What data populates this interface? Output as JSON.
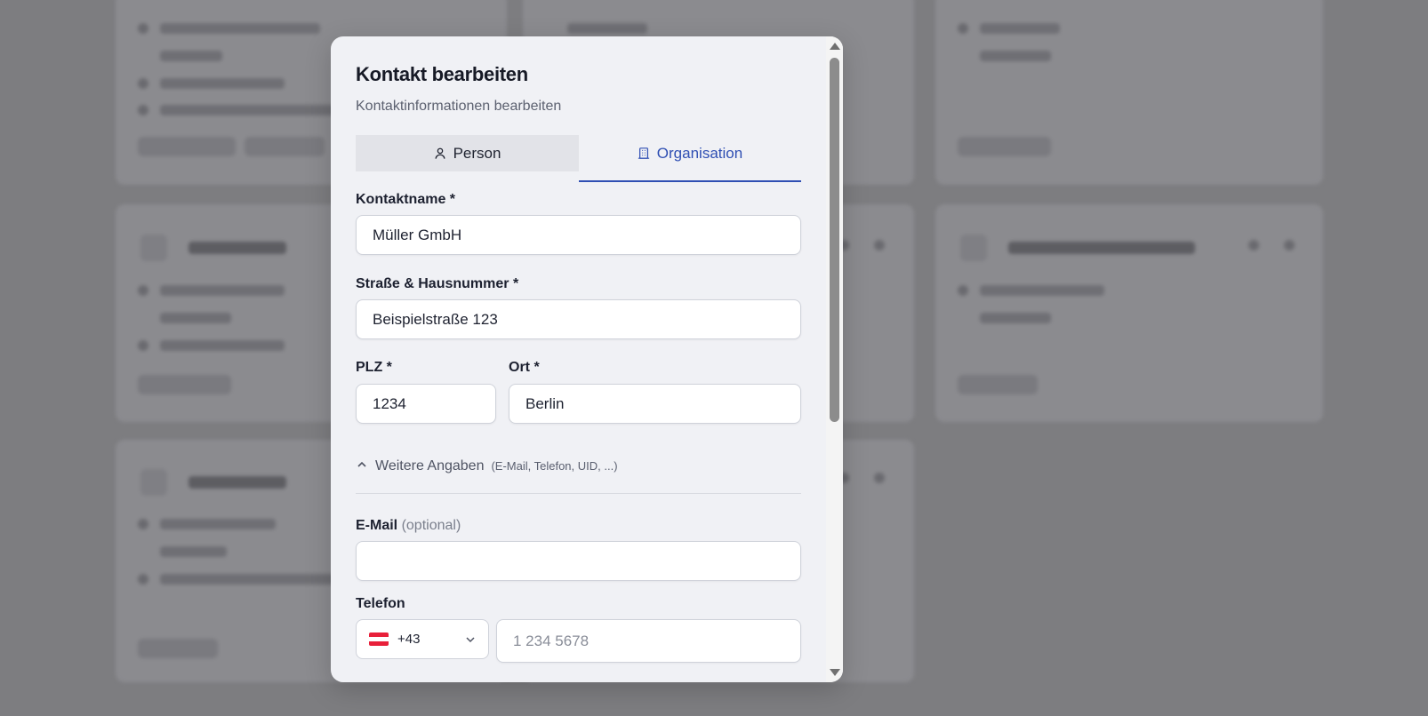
{
  "modal": {
    "title": "Kontakt bearbeiten",
    "subtitle": "Kontaktinformationen bearbeiten",
    "tabs": [
      {
        "label": "Person",
        "icon": "user-icon",
        "active": false
      },
      {
        "label": "Organisation",
        "icon": "building-icon",
        "active": true
      }
    ],
    "fields": {
      "name": {
        "label": "Kontaktname *",
        "value": "Müller GmbH"
      },
      "street": {
        "label": "Straße & Hausnummer *",
        "value": "Beispielstraße 123"
      },
      "zip": {
        "label": "PLZ *",
        "value": "1234"
      },
      "city": {
        "label": "Ort *",
        "value": "Berlin"
      },
      "email": {
        "label": "E-Mail",
        "optional": "(optional)",
        "value": ""
      },
      "phone": {
        "label": "Telefon",
        "country_code": "+43",
        "placeholder": "1 234 5678",
        "value": ""
      }
    },
    "more": {
      "label": "Weitere Angaben",
      "hint": "(E-Mail, Telefon, UID, ...)",
      "expanded": true
    }
  },
  "colors": {
    "accent": "#2f4fb3",
    "flag_red": "#e8203a",
    "flag_white": "#ffffff"
  }
}
